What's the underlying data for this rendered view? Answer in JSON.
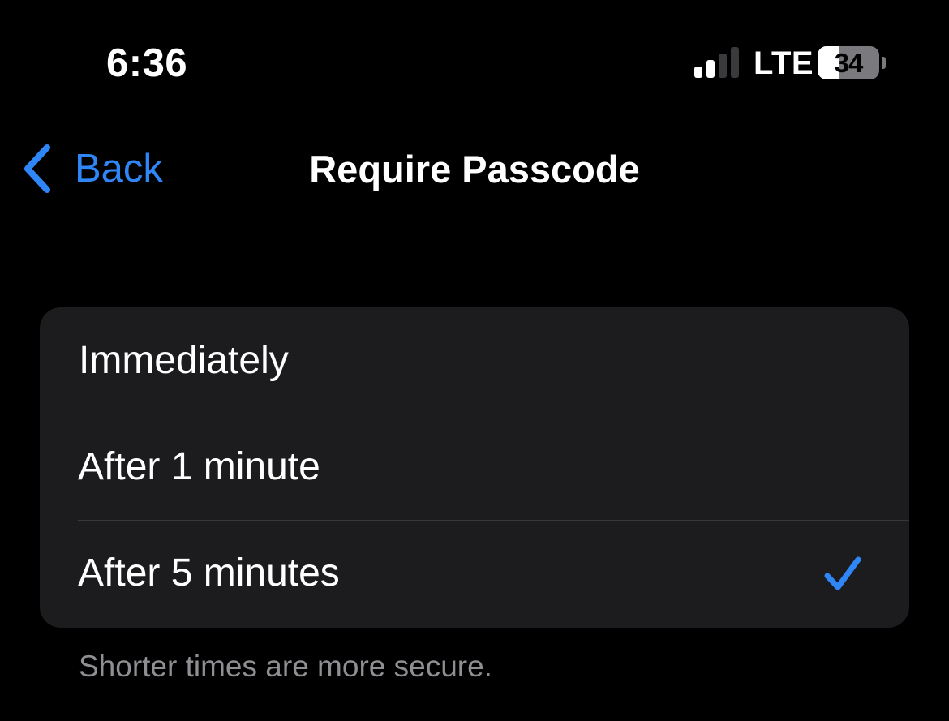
{
  "status_bar": {
    "time": "6:36",
    "network": "LTE",
    "battery_level": "34",
    "battery_fraction": 0.34,
    "signal_bars_active": 2,
    "signal_bars_total": 4
  },
  "nav": {
    "back_label": "Back",
    "title": "Require Passcode"
  },
  "options": [
    {
      "label": "Immediately",
      "selected": false
    },
    {
      "label": "After 1 minute",
      "selected": false
    },
    {
      "label": "After 5 minutes",
      "selected": true
    }
  ],
  "footer": "Shorter times are more secure.",
  "colors": {
    "accent": "#2f86f6",
    "background": "#000000",
    "group_background": "#1c1c1e",
    "secondary_text": "#8e8e93"
  }
}
